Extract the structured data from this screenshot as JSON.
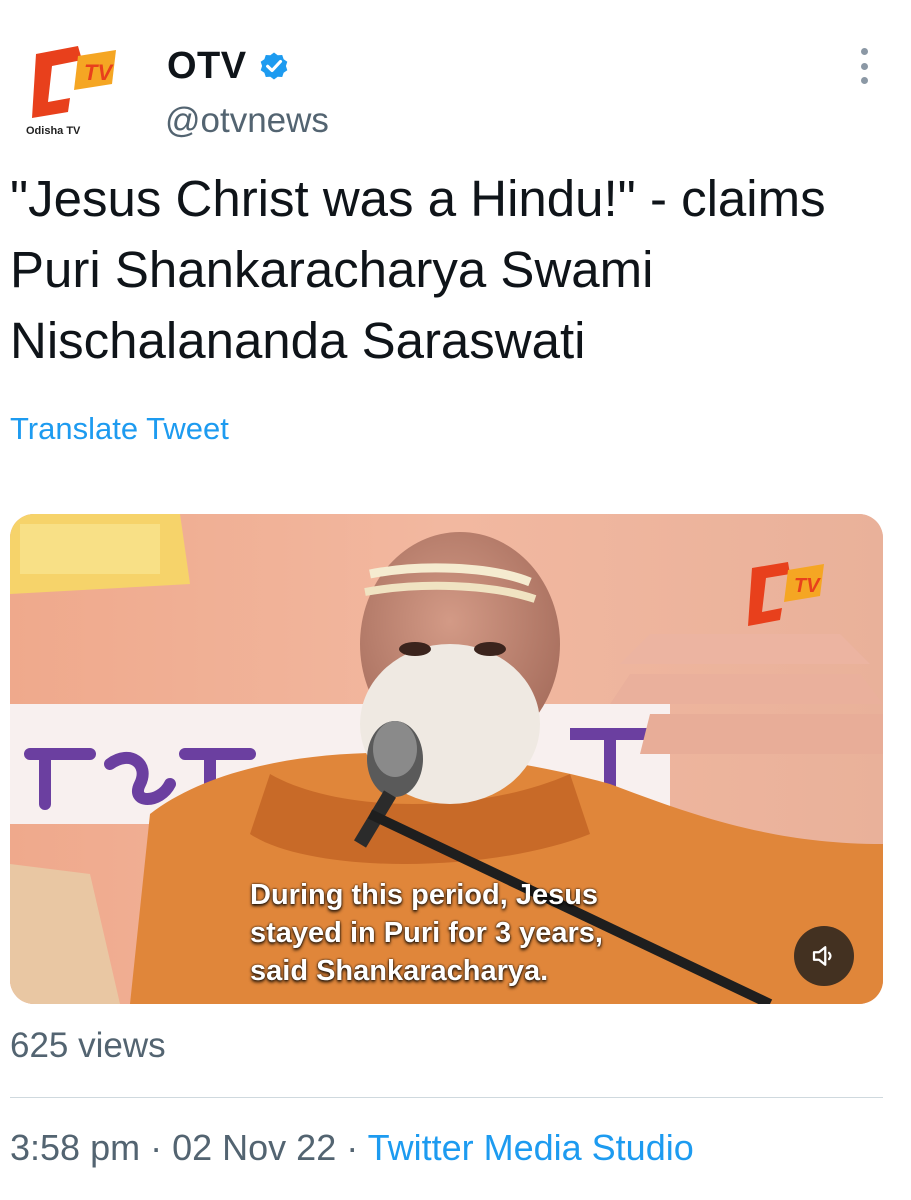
{
  "author": {
    "name": "OTV",
    "handle": "@otvnews",
    "logo_caption": "Odisha TV",
    "logo_badge": "TV",
    "verified_icon": "verified-badge-icon"
  },
  "tweet": {
    "text": "\"Jesus Christ was a Hindu!\" - claims Puri Shankaracharya Swami Nischalananda Saraswati",
    "translate_label": "Translate Tweet"
  },
  "media": {
    "type": "video",
    "caption_lines": [
      "During this period, Jesus",
      "stayed in Puri for 3 years,",
      "said Shankaracharya."
    ],
    "watermark": "TV",
    "sound_icon": "speaker-muted-icon"
  },
  "stats": {
    "views": "625 views"
  },
  "meta": {
    "time": "3:58 pm",
    "separator": "·",
    "date": "02 Nov 22",
    "source": "Twitter Media Studio"
  },
  "colors": {
    "accent": "#1d9bf0",
    "secondary_text": "#536471",
    "otv_red": "#e8401c",
    "otv_orange": "#f5a623"
  }
}
